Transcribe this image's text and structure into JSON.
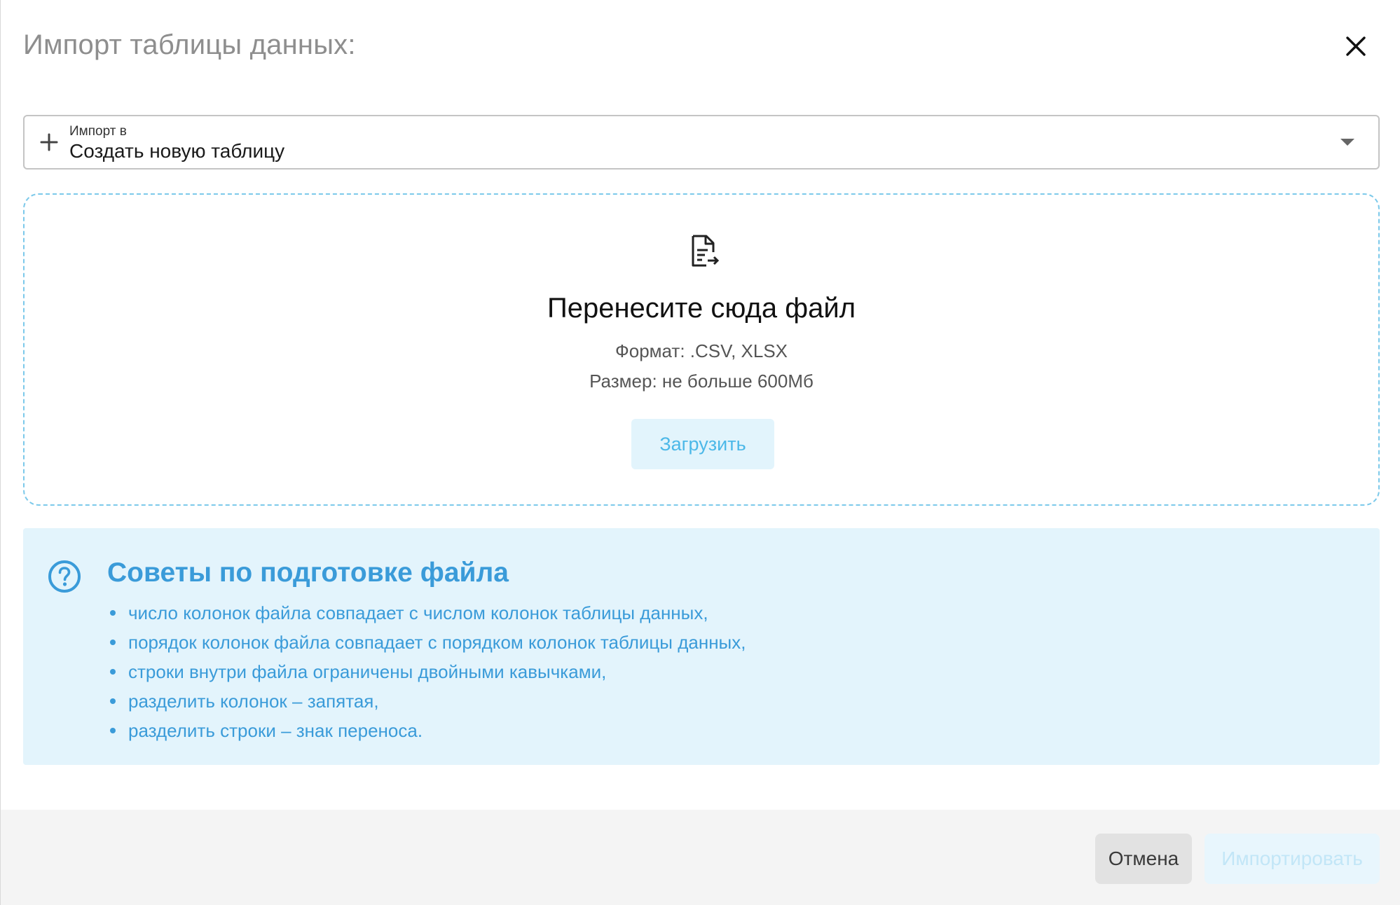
{
  "dialog": {
    "title": "Импорт таблицы данных:"
  },
  "select": {
    "label": "Импорт в",
    "value": "Создать новую таблицу"
  },
  "dropzone": {
    "title": "Перенесите сюда файл",
    "format": "Формат: .CSV, XLSX",
    "size": "Размер: не больше 600Мб",
    "upload_label": "Загрузить"
  },
  "tips": {
    "title": "Советы по подготовке файла",
    "items": [
      "число колонок файла совпадает с числом колонок таблицы данных,",
      "порядок колонок файла совпадает с порядком колонок таблицы данных,",
      "строки внутри файла ограничены двойными кавычками,",
      "разделить колонок – запятая,",
      "разделить строки – знак переноса."
    ]
  },
  "footer": {
    "cancel_label": "Отмена",
    "import_label": "Импортировать"
  },
  "icons": {
    "close": "close-icon",
    "plus": "plus-icon",
    "dropdown": "chevron-down-icon",
    "file": "file-import-icon",
    "help": "help-circle-icon"
  },
  "colors": {
    "accent": "#3a9bd9",
    "upload_text": "#4cb8e8",
    "tips_bg": "#e3f4fc",
    "dropzone_border": "#7cc9ea"
  }
}
